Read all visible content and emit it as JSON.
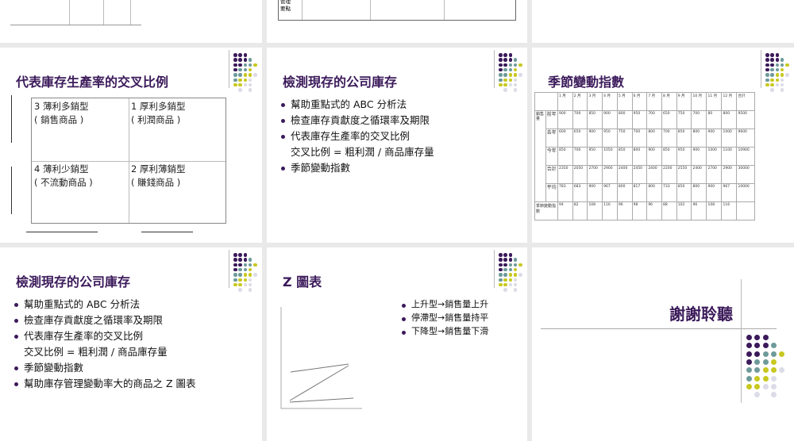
{
  "slides": [
    {
      "partial_table_label": "管理要點"
    },
    {
      "title": "代表庫存生產率的交叉比例",
      "quadrants": [
        {
          "line1": "3 薄利多銷型",
          "line2": "( 銷售商品 )"
        },
        {
          "line1": "1  厚利多銷型",
          "line2": "( 利潤商品 )"
        },
        {
          "line1": "4 薄利少銷型",
          "line2": "( 不流動商品 )"
        },
        {
          "line1": "2 厚利薄銷型",
          "line2": "( 賺錢商品 )"
        }
      ]
    },
    {
      "title": "檢測現存的公司庫存",
      "bullets": [
        "幫助重點式的 ABC 分析法",
        "檢查庫存貢獻度之循環率及期限",
        "代表庫存生產率的交叉比例"
      ],
      "sub": "交叉比例 = 粗利潤 / 商品庫存量",
      "last": "季節變動指數"
    },
    {
      "title": "季節變動指數",
      "table": {
        "headers": [
          "1 月",
          "2 月",
          "3 月",
          "4 月",
          "5 月",
          "6 月",
          "7 月",
          "8 月",
          "9 月",
          "10 月",
          "11 月",
          "12 月",
          "合計"
        ],
        "group": "銷售量",
        "rows": [
          {
            "label": "前年",
            "values": [
              "900",
              "700",
              "850",
              "900",
              "800",
              "950",
              "700",
              "650",
              "750",
              "700",
              "80",
              "800",
              "9500"
            ]
          },
          {
            "label": "去年",
            "values": [
              "600",
              "650",
              "900",
              "950",
              "750",
              "700",
              "800",
              "700",
              "850",
              "800",
              "900",
              "1000",
              "9600"
            ]
          },
          {
            "label": "今年",
            "values": [
              "850",
              "700",
              "950",
              "1050",
              "850",
              "800",
              "900",
              "850",
              "950",
              "900",
              "1000",
              "1100",
              "10900"
            ]
          },
          {
            "label": "合計",
            "values": [
              "2350",
              "2050",
              "2700",
              "2900",
              "2400",
              "2450",
              "2400",
              "2200",
              "2550",
              "2400",
              "2700",
              "2900",
              "30000"
            ]
          },
          {
            "label": "平均",
            "values": [
              "783",
              "683",
              "900",
              "967",
              "800",
              "817",
              "800",
              "733",
              "850",
              "800",
              "900",
              "967",
              "10000"
            ]
          }
        ],
        "index_label": "季節變動指數",
        "index_values": [
          "94",
          "82",
          "108",
          "116",
          "96",
          "98",
          "96",
          "88",
          "102",
          "96",
          "108",
          "116",
          ""
        ]
      }
    },
    {
      "title": "檢測現存的公司庫存",
      "bullets": [
        "幫助重點式的 ABC 分析法",
        "檢查庫存貢獻度之循環率及期限",
        "代表庫存生產率的交叉比例"
      ],
      "sub": "交叉比例 = 粗利潤 / 商品庫存量",
      "after": [
        "季節變動指數",
        "幫助庫存管理變動率大的商品之 Z 圖表"
      ]
    },
    {
      "title": "Z 圖表",
      "bullets": [
        "上升型→銷售量上升",
        "停滯型→銷售量持平",
        "下降型→銷售量下滑"
      ]
    },
    {
      "title": "謝謝聆聽"
    }
  ],
  "colors": {
    "purple": "#3b1a5a",
    "teal": "#6e9a9a",
    "yellow": "#c8c820",
    "light": "#dcdce8"
  }
}
